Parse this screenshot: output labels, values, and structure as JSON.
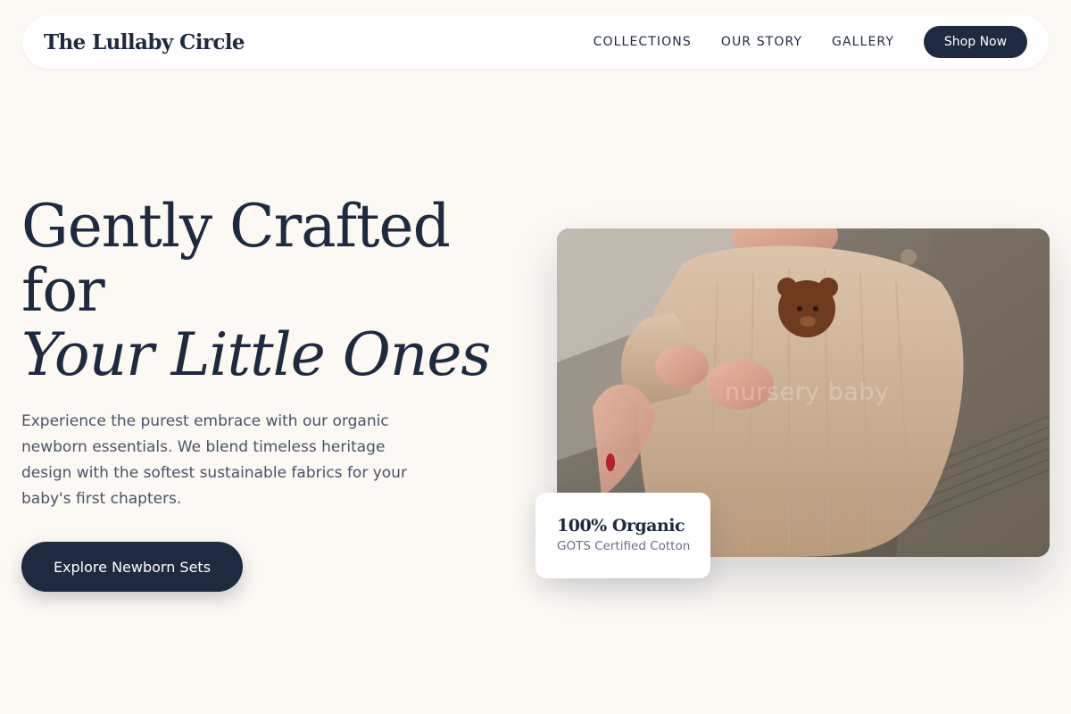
{
  "colors": {
    "background": "#fcf8f3",
    "navy": "#1e2a40",
    "body_text": "#475467",
    "muted_text": "#667085",
    "card": "#ffffff"
  },
  "header": {
    "brand": "The Lullaby Circle",
    "nav": [
      "COLLECTIONS",
      "OUR STORY",
      "GALLERY"
    ],
    "cta": "Shop Now"
  },
  "hero": {
    "title_line1": "Gently Crafted",
    "title_line2": "for",
    "title_line3": "Your Little Ones",
    "description": "Experience the purest embrace with our organic newborn essentials. We blend timeless heritage design with the softest sustainable fabrics for your baby's first chapters.",
    "cta": "Explore Newborn Sets"
  },
  "image": {
    "watermark": "nursery baby"
  },
  "badge": {
    "title": "100% Organic",
    "subtitle": "GOTS Certified Cotton"
  }
}
